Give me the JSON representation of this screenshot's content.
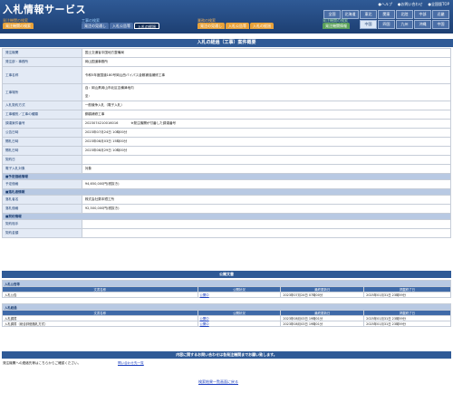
{
  "header": {
    "logo": "入札情報サービス",
    "links": [
      "●ヘルプ",
      "●お問い合わせ",
      "●全国版TOP"
    ],
    "region_tabs_row1": [
      "全国",
      "北海道",
      "東北",
      "関東",
      "北陸",
      "中部",
      "近畿"
    ],
    "region_tabs_row2": [
      "中国",
      "四国",
      "九州",
      "沖縄",
      "中国"
    ],
    "selected_region": "中国"
  },
  "nav": {
    "groups": [
      {
        "title": "発注機関の検索",
        "tabs": [
          {
            "label": "発注機関の検索",
            "color": "#e8a23a"
          }
        ]
      },
      {
        "title": "工事の検索",
        "tabs": [
          {
            "label": "発注の見通し",
            "color": "#4a6ea6"
          },
          {
            "label": "入札公告等",
            "color": "#4a6ea6"
          },
          {
            "label": "入札の経過",
            "color": "#1d3f72"
          }
        ]
      },
      {
        "title": "業務の検索",
        "tabs": [
          {
            "label": "発注の見通し",
            "color": "#e8a23a"
          },
          {
            "label": "入札公告等",
            "color": "#e8a23a"
          },
          {
            "label": "入札の経過",
            "color": "#e8a23a"
          }
        ]
      },
      {
        "title": "発注機関の検索",
        "tabs": [
          {
            "label": "発注機関情報",
            "color": "#5aa05a"
          }
        ]
      }
    ]
  },
  "page_title": "入札の経過（工事）案件概要",
  "details": [
    {
      "label": "発注機関",
      "value": "国土交通省中国地方整備局"
    },
    {
      "label": "発注部・事務所",
      "value": "岡山国道事務所"
    },
    {
      "label": "工事名称",
      "value": "令和5年度国道180号岡山西バイパス倉敷補強補修工事"
    },
    {
      "label": "工事場所",
      "value": "自：岡山県岡山市北区吉備津地内",
      "value2": "至："
    },
    {
      "label": "入札契約方式",
      "value": "一般競争入札（電子入札）"
    },
    {
      "label": "工事種別／工事の種類",
      "value": "鋼橋補修工事"
    },
    {
      "label": "調達案件番号",
      "value": "2023074210016016",
      "note": "※発注機関が付番した調達番号"
    },
    {
      "label": "公告日時",
      "value": "2023年07月24日 10時00分"
    },
    {
      "label": "開札日時",
      "value": "2023年08月03日 15時00分"
    },
    {
      "label": "開札日時",
      "value": "2023年08月29日 10時00分"
    },
    {
      "label": "契約日",
      "value": ""
    },
    {
      "label": "電子入札対象",
      "value": "対象"
    }
  ],
  "sections": {
    "budget": "■予定価格情報",
    "winner": "■落札者情報",
    "contract": "■契約情報"
  },
  "budget_rows": [
    {
      "label": "予定価格",
      "value": "94,650,000円(税抜き)"
    }
  ],
  "winner_rows": [
    {
      "label": "落札者名",
      "value": "株式会社栗本鐵工所"
    },
    {
      "label": "落札価格",
      "value": "92,500,000円(税抜き)"
    }
  ],
  "contract_rows": [
    {
      "label": "契約相手",
      "value": ""
    },
    {
      "label": "契約金額",
      "value": ""
    }
  ],
  "documents": {
    "title": "公開文書",
    "headers": [
      "文書名称",
      "公開状況",
      "最終更新日",
      "掲載終了日"
    ],
    "koukoku": {
      "title": "入札公告等",
      "rows": [
        {
          "name": "入札公告",
          "status": "公開中",
          "updated": "2023年07月24日 07時00分",
          "end": "2025年01月31日 23時59分"
        }
      ]
    },
    "keika": {
      "title": "入札経過",
      "rows": [
        {
          "name": "入札調書",
          "status": "公開中",
          "updated": "2023年08月03日 19時01分",
          "end": "2025年01月31日 23時59分"
        },
        {
          "name": "入札調書（総合評価落札方式）",
          "status": "公開中",
          "updated": "2023年08月03日 19時01分",
          "end": "2025年01月31日 23時59分"
        }
      ]
    }
  },
  "contact": {
    "title": "内容に関するお問い合わせは各発注機関までお願い致します。",
    "text": "発注機関への連絡先等はこちらからご確認ください。",
    "link": "問い合わせ先一覧"
  },
  "back_link": "検索結果一覧画面に戻る"
}
